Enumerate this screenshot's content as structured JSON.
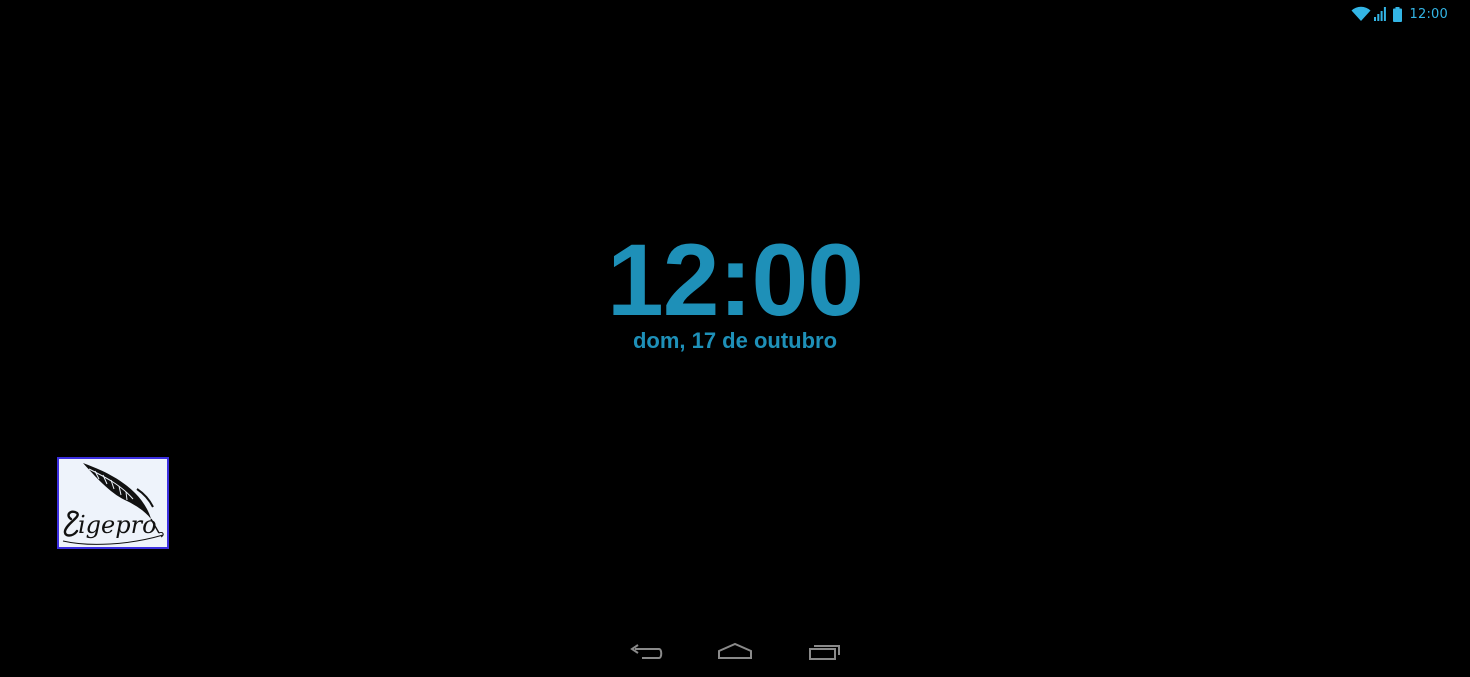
{
  "status_bar": {
    "time": "12:00",
    "icons": [
      "wifi-icon",
      "signal-icon",
      "battery-icon"
    ]
  },
  "clock_widget": {
    "time": "12:00",
    "date": "dom, 17 de outubro",
    "color": "#1e90b8"
  },
  "shortcut": {
    "app_name": "Sigepro",
    "border_color": "#3b2fe0"
  },
  "nav_bar": {
    "icons": [
      "back-icon",
      "home-icon",
      "recents-icon"
    ]
  },
  "colors": {
    "background": "#000000",
    "status_accent": "#33b5e5"
  }
}
